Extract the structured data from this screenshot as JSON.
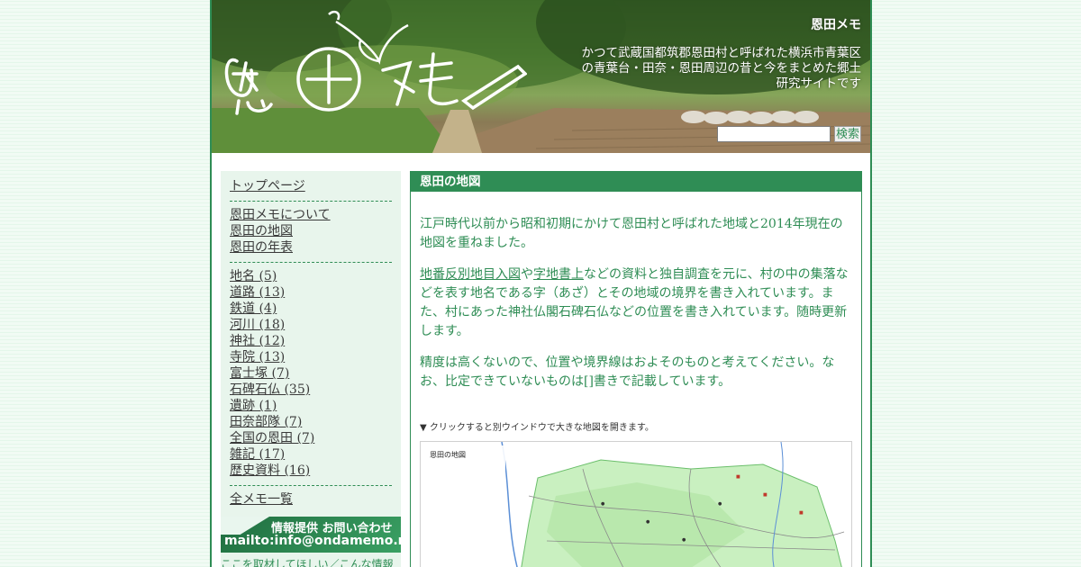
{
  "header": {
    "site_name": "恩田メモ",
    "description": "かつて武蔵国都筑郡恩田村と呼ばれた横浜市青葉区の青葉台・田奈・恩田周辺の昔と今をまとめた郷土研究サイトです",
    "search_button": "検索",
    "search_value": ""
  },
  "sidebar": {
    "top_link": "トップページ",
    "group1": [
      "恩田メモについて",
      "恩田の地図",
      "恩田の年表"
    ],
    "categories": [
      "地名 (5)",
      "道路 (13)",
      "鉄道 (4)",
      "河川 (18)",
      "神社 (12)",
      "寺院 (13)",
      "富士塚 (7)",
      "石碑石仏 (35)",
      "遺跡 (1)",
      "田奈部隊 (7)",
      "全国の恩田 (7)",
      "雑記 (17)",
      "歴史資料 (16)"
    ],
    "all_list": "全メモ一覧",
    "banner_top": "情報提供 お問い合わせ",
    "banner_bottom": "mailto:info@ondamemo.net",
    "note": "ここを取材してほしい／こんな情報"
  },
  "main": {
    "title": "恩田の地図",
    "para1": "江戸時代以前から昭和初期にかけて恩田村と呼ばれた地域と2014年現在の地図を重ねました。",
    "para2_link1": "地番反別地目入図",
    "para2_mid": "や",
    "para2_link2": "字地書上",
    "para2_rest": "などの資料と独自調査を元に、村の中の集落などを表す地名である字（あざ）とその地域の境界を書き入れています。また、村にあった神社仏閣石碑石仏などの位置を書き入れています。随時更新します。",
    "para3": "精度は高くないので、位置や境界線はおよそのものと考えてください。なお、比定できていないものは[]書きで記載しています。",
    "map_note": "▼ クリックすると別ウインドウで大きな地図を開きます。",
    "map_title": "恩田の地図"
  }
}
